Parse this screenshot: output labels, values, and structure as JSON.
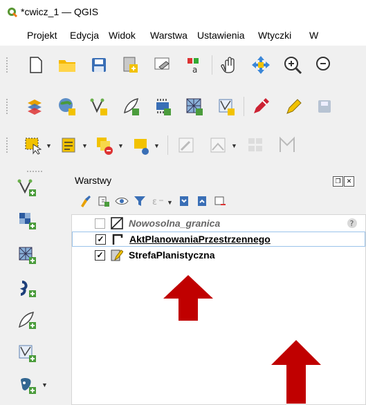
{
  "window": {
    "title": "*cwicz_1 — QGIS"
  },
  "menu": [
    "Projekt",
    "Edycja",
    "Widok",
    "Warstwa",
    "Ustawienia",
    "Wtyczki",
    "W"
  ],
  "colors": {
    "accent_arrow": "#c00000",
    "selection_border": "#9ac3ea",
    "panel_bg": "#f0f0f0"
  },
  "panel": {
    "title": "Warstwy",
    "layers": [
      {
        "name": "Nowosolna_granica",
        "checked": false,
        "missing": true
      },
      {
        "name": "AktPlanowaniaPrzestrzennego",
        "checked": true,
        "missing": false
      },
      {
        "name": "StrefaPlanistyczna",
        "checked": true,
        "missing": false
      }
    ]
  },
  "checks": {
    "on": "✓",
    "off": ""
  }
}
